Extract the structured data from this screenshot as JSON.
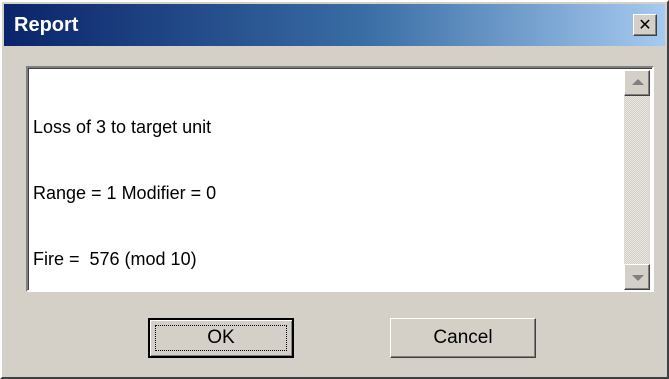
{
  "window": {
    "title": "Report",
    "close_glyph": "✕",
    "close_icon": "close-icon"
  },
  "report": {
    "lines": [
      "Loss of 3 to target unit",
      "Range = 1 Modifier = 0",
      "Fire =  576 (mod 10)"
    ],
    "scroll_up_icon": "scroll-up-arrow-icon",
    "scroll_down_icon": "scroll-down-arrow-icon"
  },
  "buttons": {
    "ok_label": "OK",
    "cancel_label": "Cancel"
  },
  "colors": {
    "titlebar_start": "#0a246a",
    "titlebar_end": "#a6caf0",
    "face": "#d4d0c8"
  }
}
